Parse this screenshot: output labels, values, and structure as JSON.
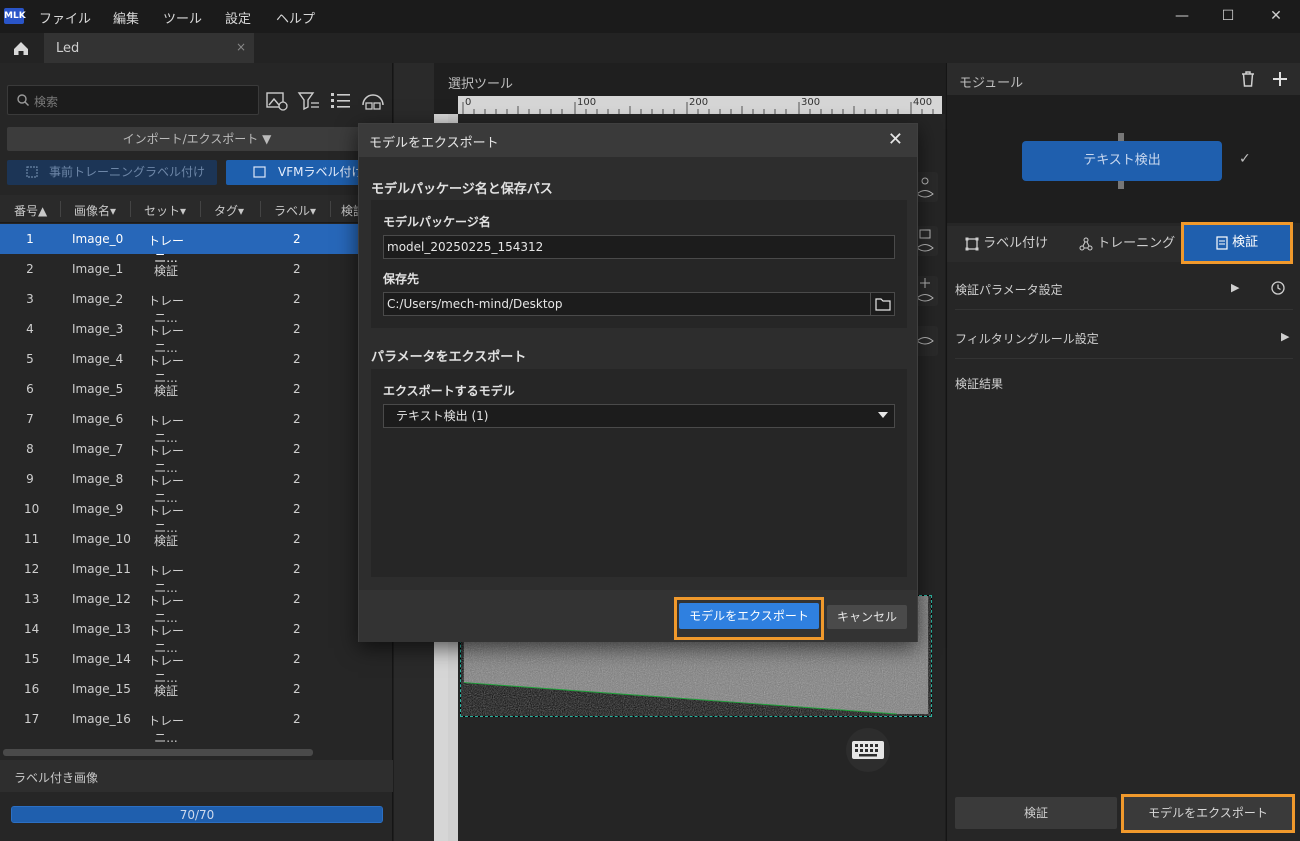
{
  "menu": [
    "ファイル",
    "編集",
    "ツール",
    "設定",
    "ヘルプ"
  ],
  "app_logo": "MLK",
  "window_controls": {
    "minimize": "—",
    "maximize": "☐",
    "close": "✕"
  },
  "document_tab": {
    "label": "Led",
    "close": "×"
  },
  "left_panel": {
    "search_placeholder": "検索",
    "import_export": "インポート/エクスポート ▼",
    "pretrain_label_button": "事前トレーニングラベル付け",
    "vfm_label_button": "VFMラベル付け",
    "columns": [
      "番号▲",
      "画像名▾",
      "セット▾",
      "タグ▾",
      "ラベル▾",
      "検証"
    ],
    "rows": [
      {
        "no": "1",
        "name": "Image_0",
        "set": "トレーニ...",
        "label": "2"
      },
      {
        "no": "2",
        "name": "Image_1",
        "set": "検証",
        "label": "2"
      },
      {
        "no": "3",
        "name": "Image_2",
        "set": "トレーニ...",
        "label": "2"
      },
      {
        "no": "4",
        "name": "Image_3",
        "set": "トレーニ...",
        "label": "2"
      },
      {
        "no": "5",
        "name": "Image_4",
        "set": "トレーニ...",
        "label": "2"
      },
      {
        "no": "6",
        "name": "Image_5",
        "set": "検証",
        "label": "2"
      },
      {
        "no": "7",
        "name": "Image_6",
        "set": "トレーニ...",
        "label": "2"
      },
      {
        "no": "8",
        "name": "Image_7",
        "set": "トレーニ...",
        "label": "2"
      },
      {
        "no": "9",
        "name": "Image_8",
        "set": "トレーニ...",
        "label": "2"
      },
      {
        "no": "10",
        "name": "Image_9",
        "set": "トレーニ...",
        "label": "2"
      },
      {
        "no": "11",
        "name": "Image_10",
        "set": "検証",
        "label": "2"
      },
      {
        "no": "12",
        "name": "Image_11",
        "set": "トレーニ...",
        "label": "2"
      },
      {
        "no": "13",
        "name": "Image_12",
        "set": "トレーニ...",
        "label": "2"
      },
      {
        "no": "14",
        "name": "Image_13",
        "set": "トレーニ...",
        "label": "2"
      },
      {
        "no": "15",
        "name": "Image_14",
        "set": "トレーニ...",
        "label": "2"
      },
      {
        "no": "16",
        "name": "Image_15",
        "set": "検証",
        "label": "2"
      },
      {
        "no": "17",
        "name": "Image_16",
        "set": "トレーニ...",
        "label": "2"
      }
    ],
    "selected_row": 0,
    "labeled_images_title": "ラベル付き画像",
    "labeled_progress_text": "70/70",
    "labeled_progress_fraction": 1.0
  },
  "canvas": {
    "title": "選択ツール",
    "ruler_ticks": [
      "0",
      "100",
      "200",
      "300",
      "400"
    ]
  },
  "right_panel": {
    "title": "モジュール",
    "module_node": "テキスト検出",
    "tabs": {
      "label": "ラベル付け",
      "training": "トレーニング",
      "verify": "検証"
    },
    "verify_params": "検証パラメータ設定",
    "filter_rules": "フィルタリングルール設定",
    "verify_results": "検証結果",
    "verify_button": "検証",
    "export_button": "モデルをエクスポート"
  },
  "modal": {
    "title": "モデルをエクスポート",
    "close": "✕",
    "section1_title": "モデルパッケージ名と保存パス",
    "package_name_label": "モデルパッケージ名",
    "package_name_value": "model_20250225_154312",
    "save_to_label": "保存先",
    "save_to_value": "C:/Users/mech-mind/Desktop",
    "section2_title": "パラメータをエクスポート",
    "export_model_label": "エクスポートするモデル",
    "export_model_value": "テキスト検出 (1)",
    "export_button": "モデルをエクスポート",
    "cancel_button": "キャンセル"
  },
  "colors": {
    "accent": "#1f5fae",
    "highlight": "#f0992c",
    "primary_button": "#2f80e0"
  }
}
